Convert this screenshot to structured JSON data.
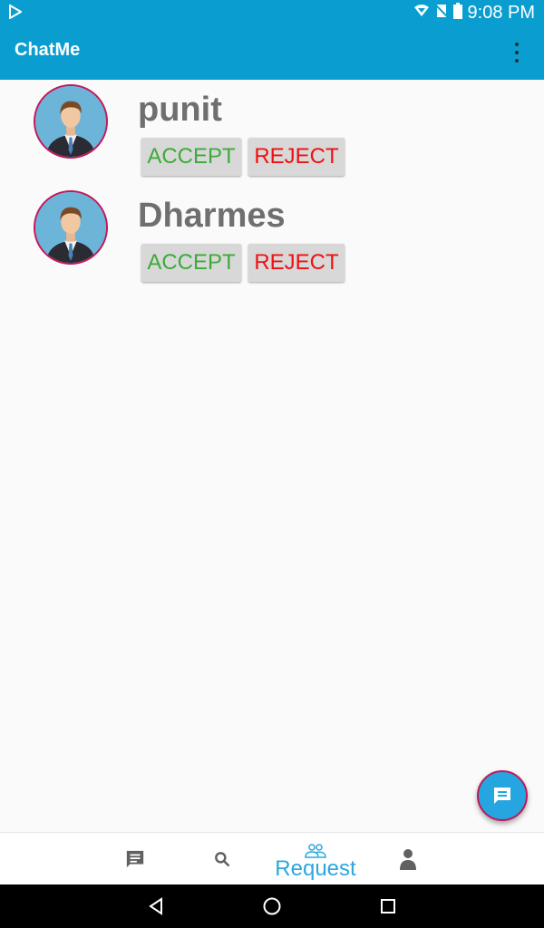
{
  "status_bar": {
    "time": "9:08 PM",
    "icons": [
      "play-store-icon",
      "wifi-icon",
      "no-sim-icon",
      "battery-icon"
    ]
  },
  "app_bar": {
    "title": "ChatMe",
    "menu_icon": "more-vert-icon"
  },
  "requests": [
    {
      "name": "punit",
      "accept_label": "ACCEPT",
      "reject_label": "REJECT"
    },
    {
      "name": "Dharmes",
      "accept_label": "ACCEPT",
      "reject_label": "REJECT"
    }
  ],
  "fab": {
    "icon": "message-icon",
    "color": "#26a6e0"
  },
  "bottom_nav": {
    "items": [
      {
        "icon": "chat-icon"
      },
      {
        "icon": "search-icon"
      },
      {
        "icon": "people-icon",
        "label": "Request",
        "active": true
      },
      {
        "icon": "person-icon"
      }
    ]
  },
  "system_nav": {
    "icons": [
      "back-icon",
      "home-icon",
      "recents-icon"
    ]
  },
  "colors": {
    "primary": "#0a9ed0",
    "accept": "#3daa3a",
    "reject": "#ee1111",
    "accent": "#29a8e0",
    "avatar_border": "#c2185b"
  }
}
